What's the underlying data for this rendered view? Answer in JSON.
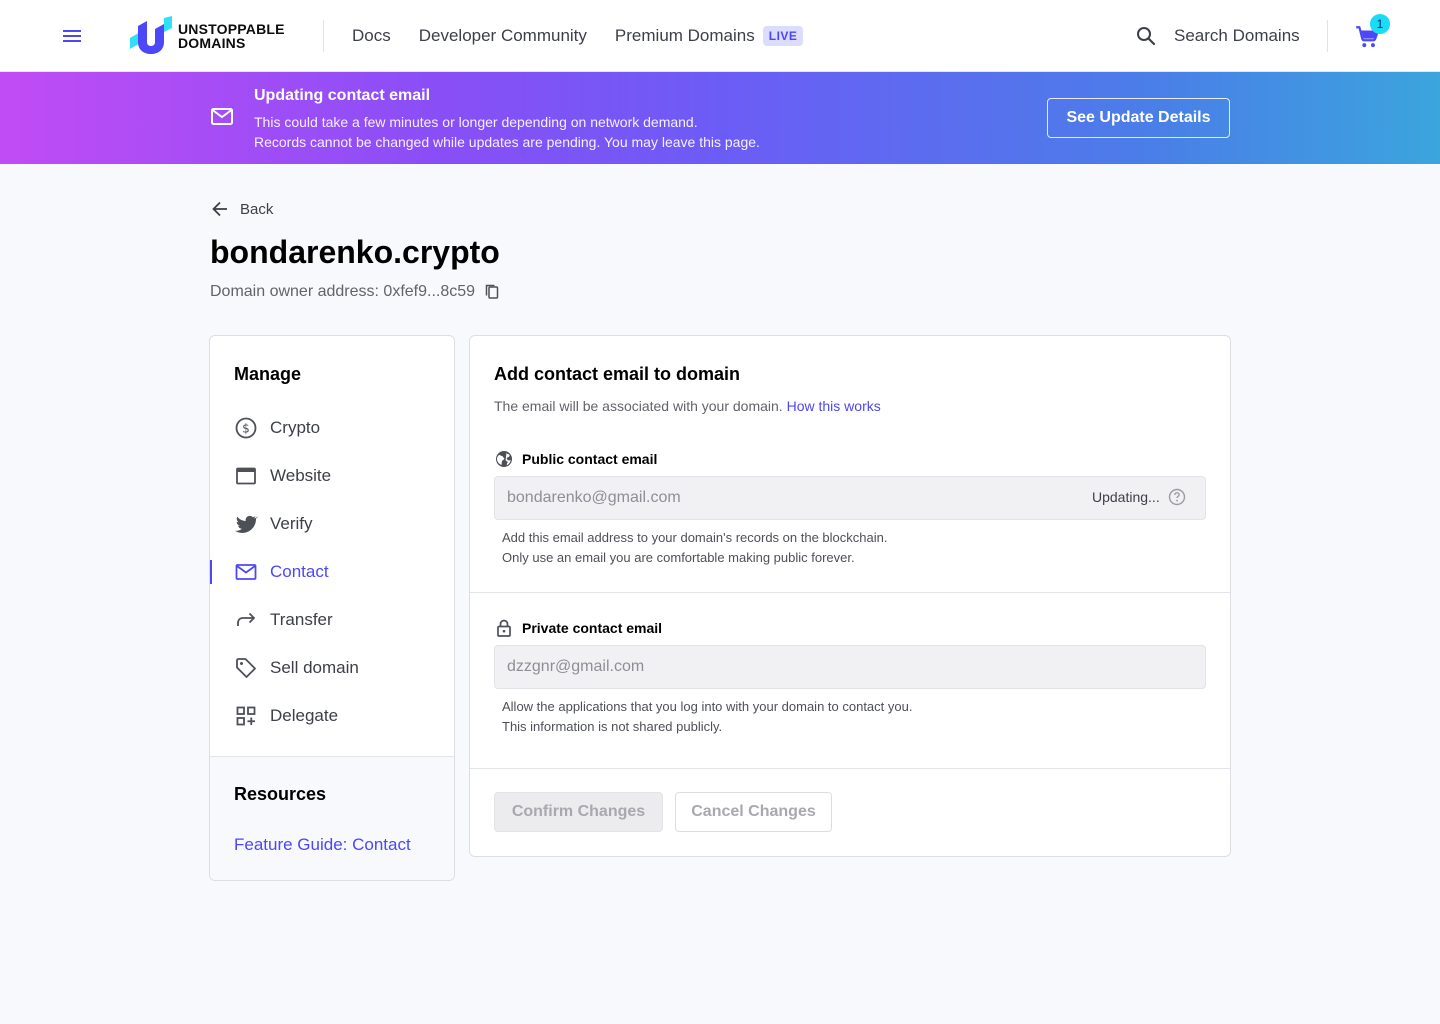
{
  "header": {
    "logo_line1": "UNSTOPPABLE",
    "logo_line2": "DOMAINS",
    "nav": [
      "Docs",
      "Developer Community",
      "Premium Domains"
    ],
    "live_badge": "LIVE",
    "search_label": "Search Domains",
    "cart_count": "1"
  },
  "banner": {
    "title": "Updating contact email",
    "line1": "This could take a few minutes or longer depending on network demand.",
    "line2": "Records cannot be changed while updates are pending. You may leave this page.",
    "button": "See Update Details"
  },
  "page": {
    "back_label": "Back",
    "domain": "bondarenko.crypto",
    "owner_address": "Domain owner address: 0xfef9...8c59"
  },
  "sidebar": {
    "manage_heading": "Manage",
    "items": [
      {
        "label": "Crypto",
        "icon": "dollar-circle-icon"
      },
      {
        "label": "Website",
        "icon": "browser-window-icon"
      },
      {
        "label": "Verify",
        "icon": "twitter-icon"
      },
      {
        "label": "Contact",
        "icon": "envelope-icon"
      },
      {
        "label": "Transfer",
        "icon": "forward-arrow-icon"
      },
      {
        "label": "Sell domain",
        "icon": "tag-icon"
      },
      {
        "label": "Delegate",
        "icon": "grid-plus-icon"
      }
    ],
    "active_item": "Contact",
    "resources_heading": "Resources",
    "resource_link": "Feature Guide: Contact"
  },
  "form": {
    "title": "Add contact email to domain",
    "subtitle": "The email will be associated with your domain.",
    "subtitle_link": "How this works",
    "public": {
      "label": "Public contact email",
      "value": "bondarenko@gmail.com",
      "status": "Updating...",
      "help1": "Add this email address to your domain's records on the blockchain.",
      "help2": "Only use an email you are comfortable making public forever."
    },
    "private": {
      "label": "Private contact email",
      "value": "dzzgnr@gmail.com",
      "help1": "Allow the applications that you log into with your domain to contact you.",
      "help2": "This information is not shared publicly."
    },
    "confirm_button": "Confirm Changes",
    "cancel_button": "Cancel Changes"
  },
  "colors": {
    "accent": "#4c47f7",
    "banner_start": "#c14cf5",
    "banner_end": "#3ba5dd",
    "cart_badge": "#1bdcf7"
  }
}
